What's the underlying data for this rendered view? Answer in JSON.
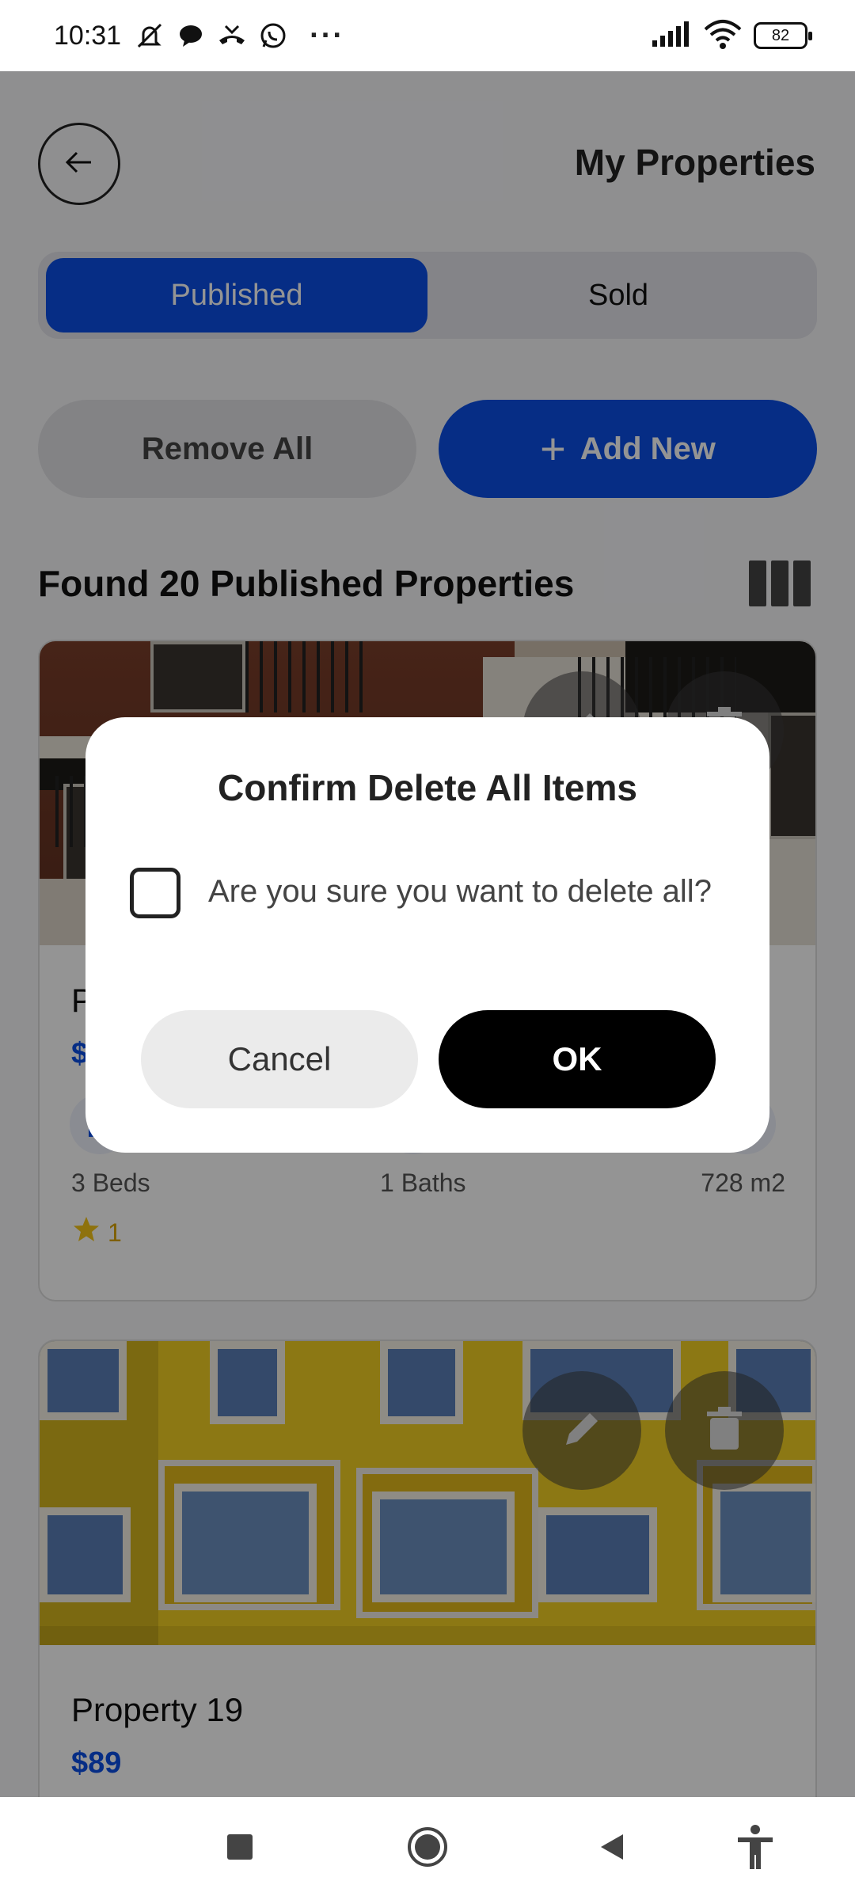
{
  "status_bar": {
    "time": "10:31",
    "battery": "82",
    "left_icons": [
      "mute-icon",
      "chat-bubble-icon",
      "missed-call-icon",
      "whatsapp-icon"
    ],
    "overflow": "···",
    "right_icons": [
      "signal-icon",
      "wifi-icon",
      "battery-icon"
    ]
  },
  "header": {
    "title": "My Properties",
    "back_icon": "arrow-left-icon"
  },
  "tabs": [
    {
      "label": "Published",
      "active": true
    },
    {
      "label": "Sold",
      "active": false
    }
  ],
  "actions": {
    "remove_all": "Remove All",
    "add_new": "Add New",
    "add_icon": "+"
  },
  "listing": {
    "found_text": "Found 20 Published Properties",
    "view_icon": "grid-columns-icon"
  },
  "cards": [
    {
      "name": "P",
      "price": "$",
      "beds": "3 Beds",
      "baths": "1 Baths",
      "area": "728 m2",
      "rating": "1"
    },
    {
      "name": "Property 19",
      "price": "$89"
    }
  ],
  "dialog": {
    "title": "Confirm Delete All Items",
    "message": "Are you sure you want to delete all?",
    "checkbox_checked": false,
    "cancel": "Cancel",
    "ok": "OK"
  },
  "nav_bar": {
    "items": [
      "recents-icon",
      "home-icon",
      "back-icon",
      "accessibility-icon"
    ]
  },
  "colors": {
    "accent": "#0b4fe6",
    "price": "#0b4fe6",
    "ok_button": "#000000",
    "star": "#d9a400"
  }
}
